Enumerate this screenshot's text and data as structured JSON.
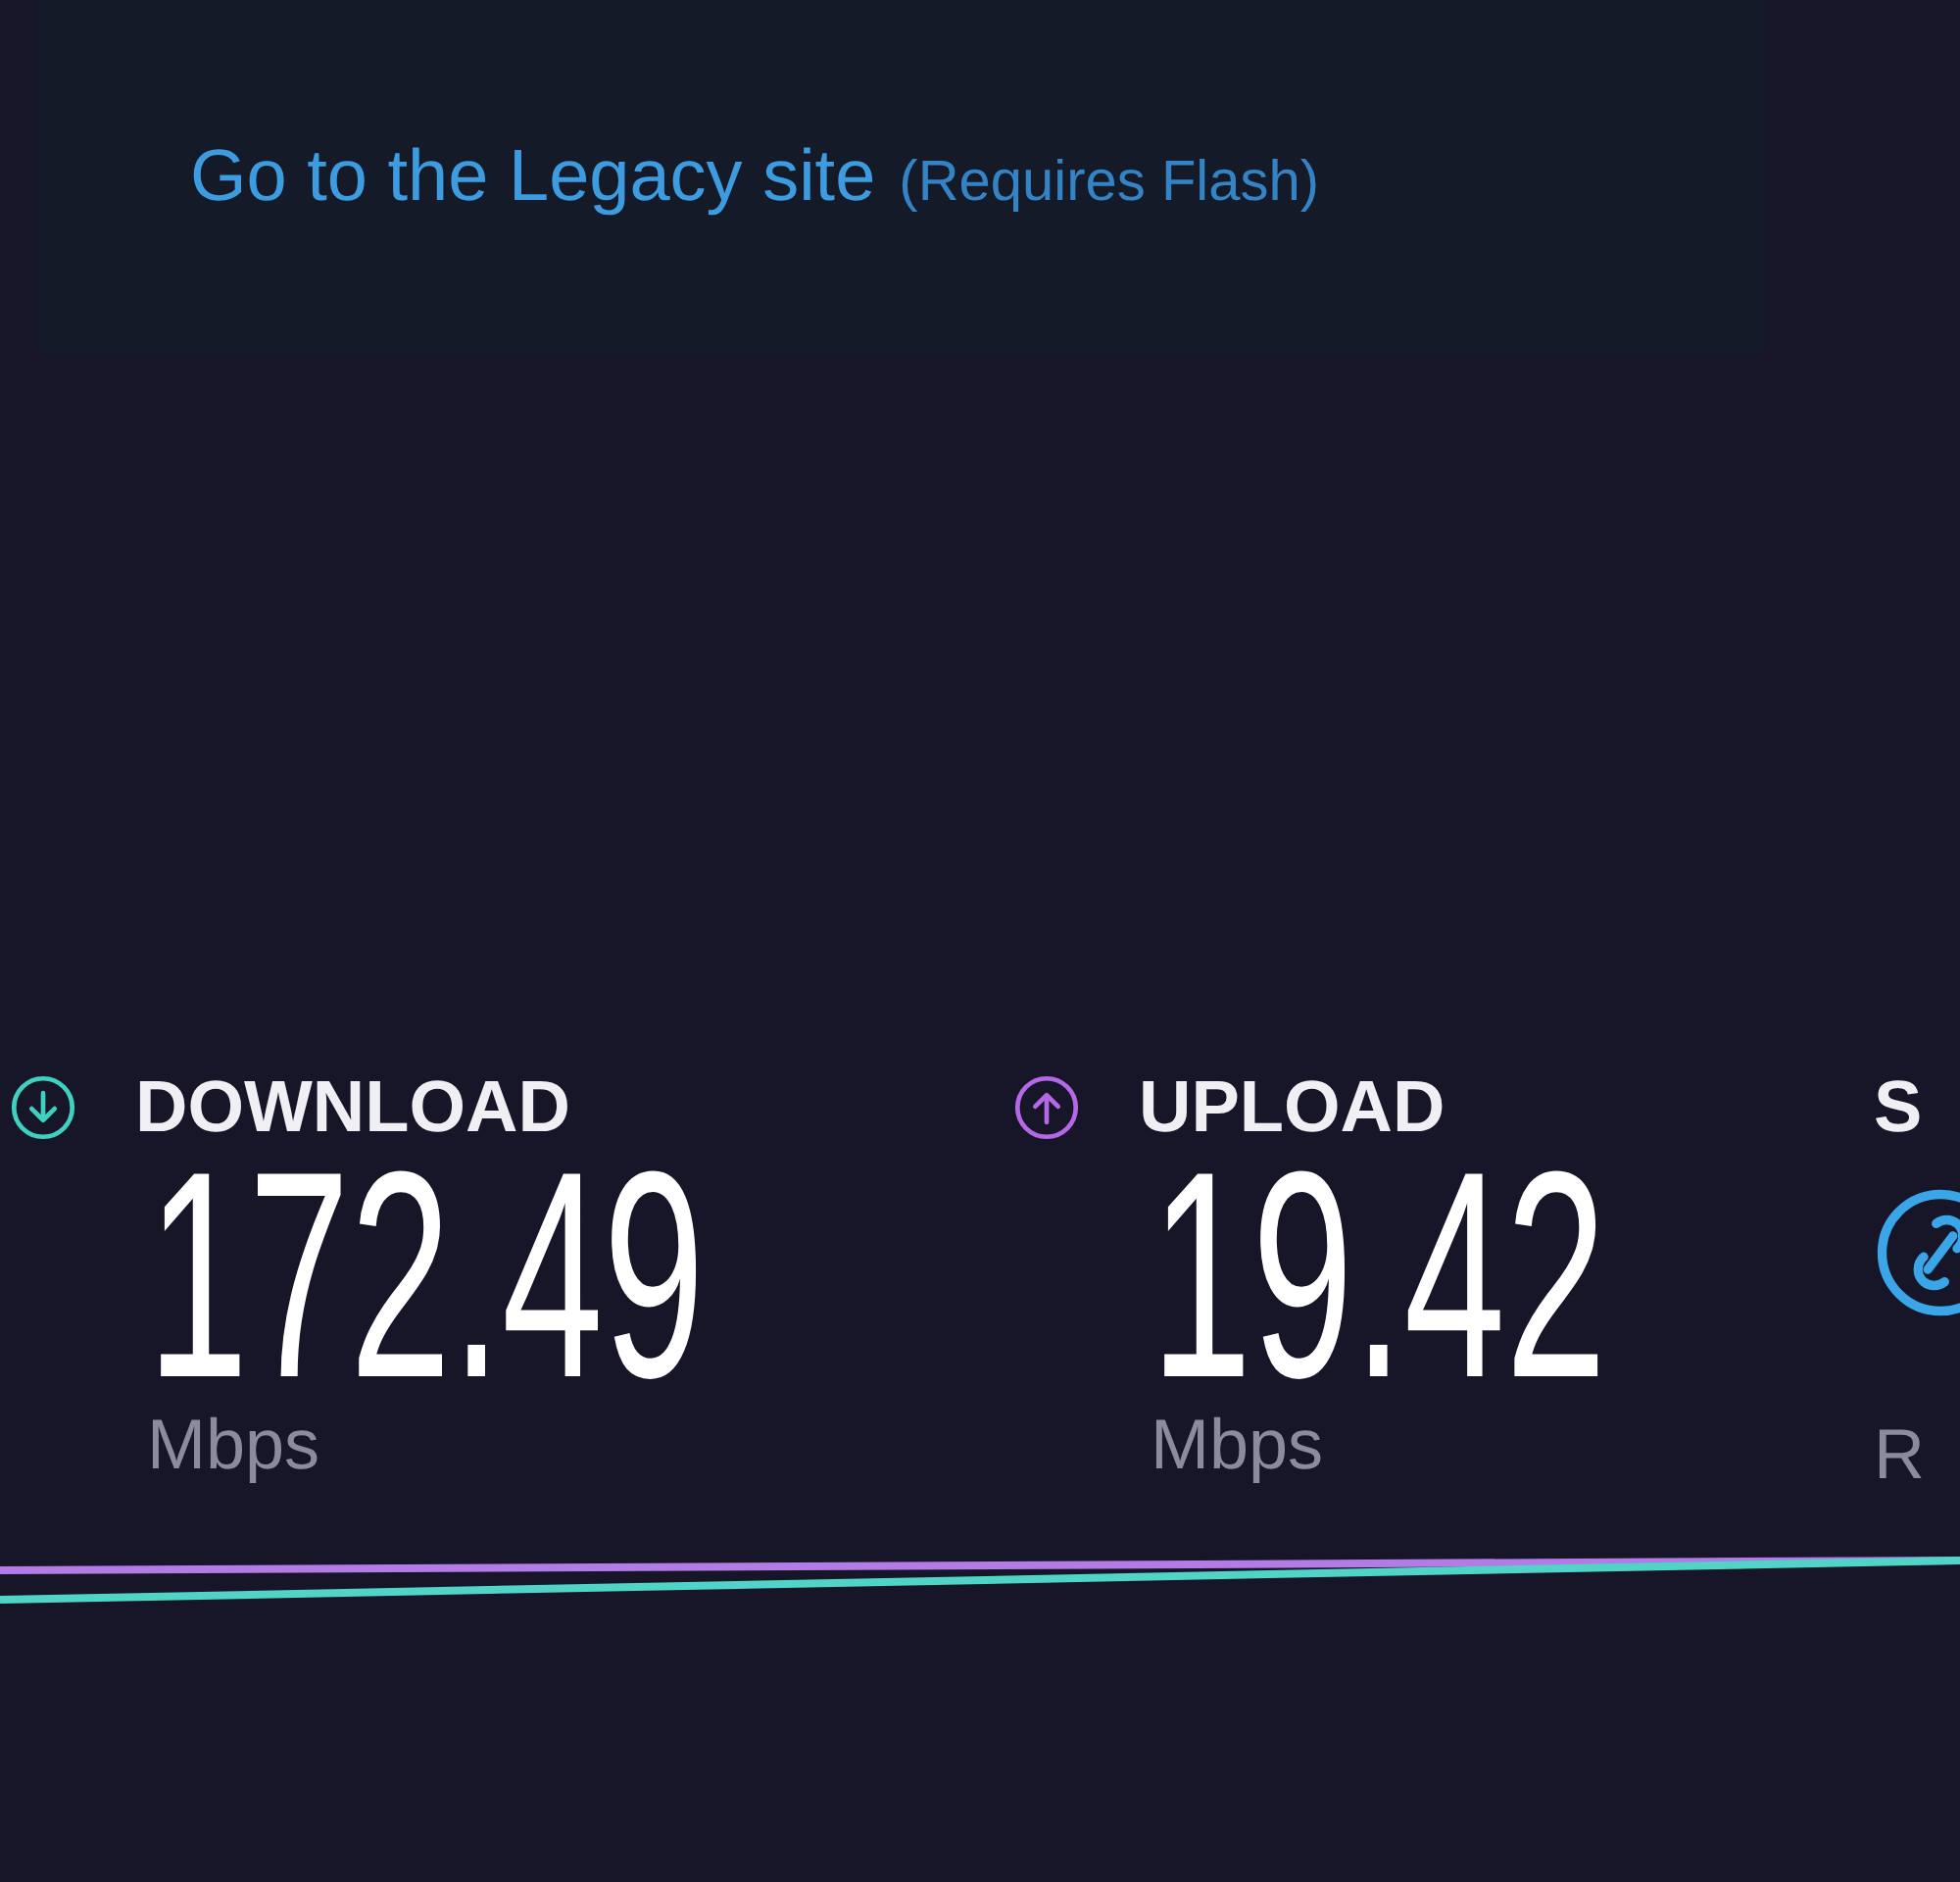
{
  "legacy_link": {
    "label": "Go to the Legacy site",
    "note": "(Requires Flash)"
  },
  "metrics": [
    {
      "kind": "download",
      "label": "DOWNLOAD",
      "value": "172.49",
      "unit": "Mbps",
      "color": "#3ed1c0"
    },
    {
      "kind": "upload",
      "label": "UPLOAD",
      "value": "19.42",
      "unit": "Mbps",
      "color": "#b468e6"
    },
    {
      "kind": "link",
      "label": "S",
      "unit": "R",
      "color": "#3aa6e8"
    }
  ]
}
